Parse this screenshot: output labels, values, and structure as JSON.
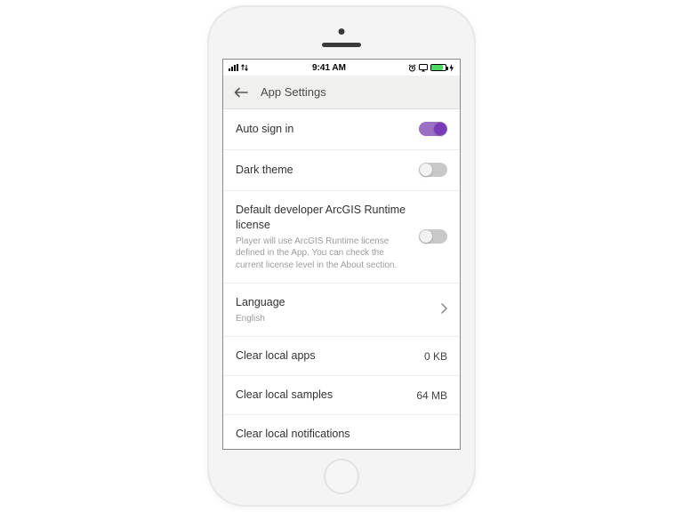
{
  "statusbar": {
    "carrier_signal": "signal",
    "time": "9:41 AM",
    "alarm_icon": "alarm",
    "airplay_icon": "airplay",
    "battery_icon": "battery",
    "charging_icon": "charging"
  },
  "nav": {
    "title": "App Settings"
  },
  "settings": {
    "auto_sign_in": {
      "label": "Auto sign in",
      "on": true
    },
    "dark_theme": {
      "label": "Dark theme",
      "on": false
    },
    "runtime_license": {
      "label": "Default developer ArcGIS Runtime license",
      "sub": "Player will use ArcGIS Runtime license defined in the App. You can check the current license level in the About section.",
      "on": false
    },
    "language": {
      "label": "Language",
      "value": "English"
    },
    "clear_apps": {
      "label": "Clear local apps",
      "value": "0 KB"
    },
    "clear_samples": {
      "label": "Clear local samples",
      "value": "64 MB"
    },
    "clear_notifications": {
      "label": "Clear local notifications"
    }
  },
  "colors": {
    "accent": "#7a3bb8",
    "accent_track": "#9b6fc3"
  }
}
